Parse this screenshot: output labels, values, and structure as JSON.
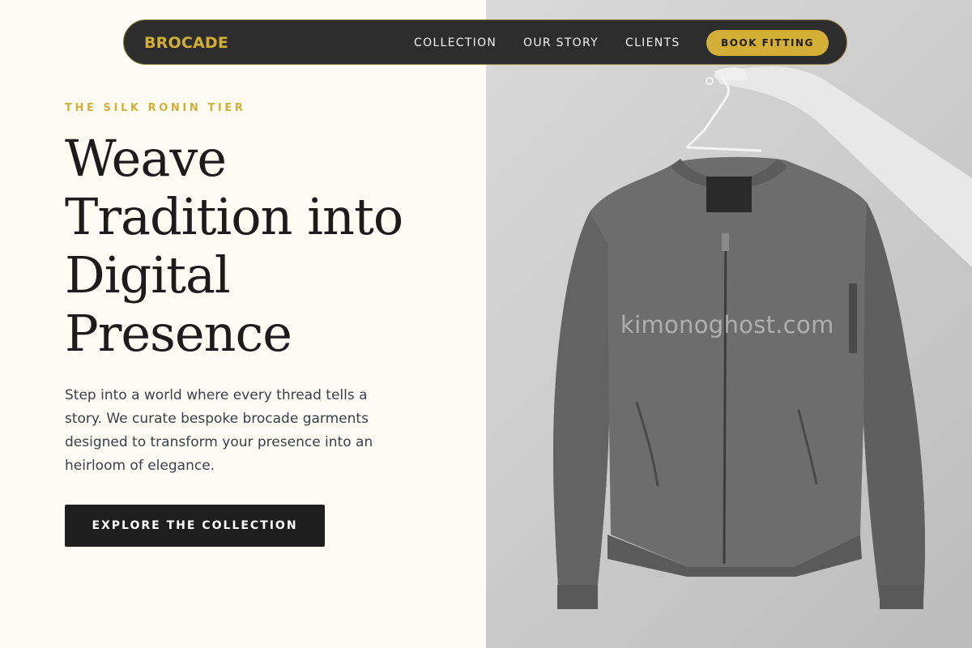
{
  "nav": {
    "brand": "BROCADE",
    "links": [
      "COLLECTION",
      "OUR STORY",
      "CLIENTS"
    ],
    "cta_label": "BOOK FITTING"
  },
  "hero": {
    "eyebrow": "THE SILK RONIN TIER",
    "headline": "Weave Tradition into Digital Presence",
    "body": "Step into a world where every thread tells a story. We curate bespoke brocade garments designed to transform your presence into an heirloom of elegance.",
    "cta_label": "EXPLORE THE COLLECTION"
  },
  "image": {
    "subject": "grey bomber jacket on hanger held by hand",
    "watermark": "kimonoghost.com"
  },
  "colors": {
    "accent": "#d4af37",
    "nav_bg": "#2d2d2d",
    "page_bg": "#fcfbf4",
    "dark_button": "#1e1e1e"
  }
}
